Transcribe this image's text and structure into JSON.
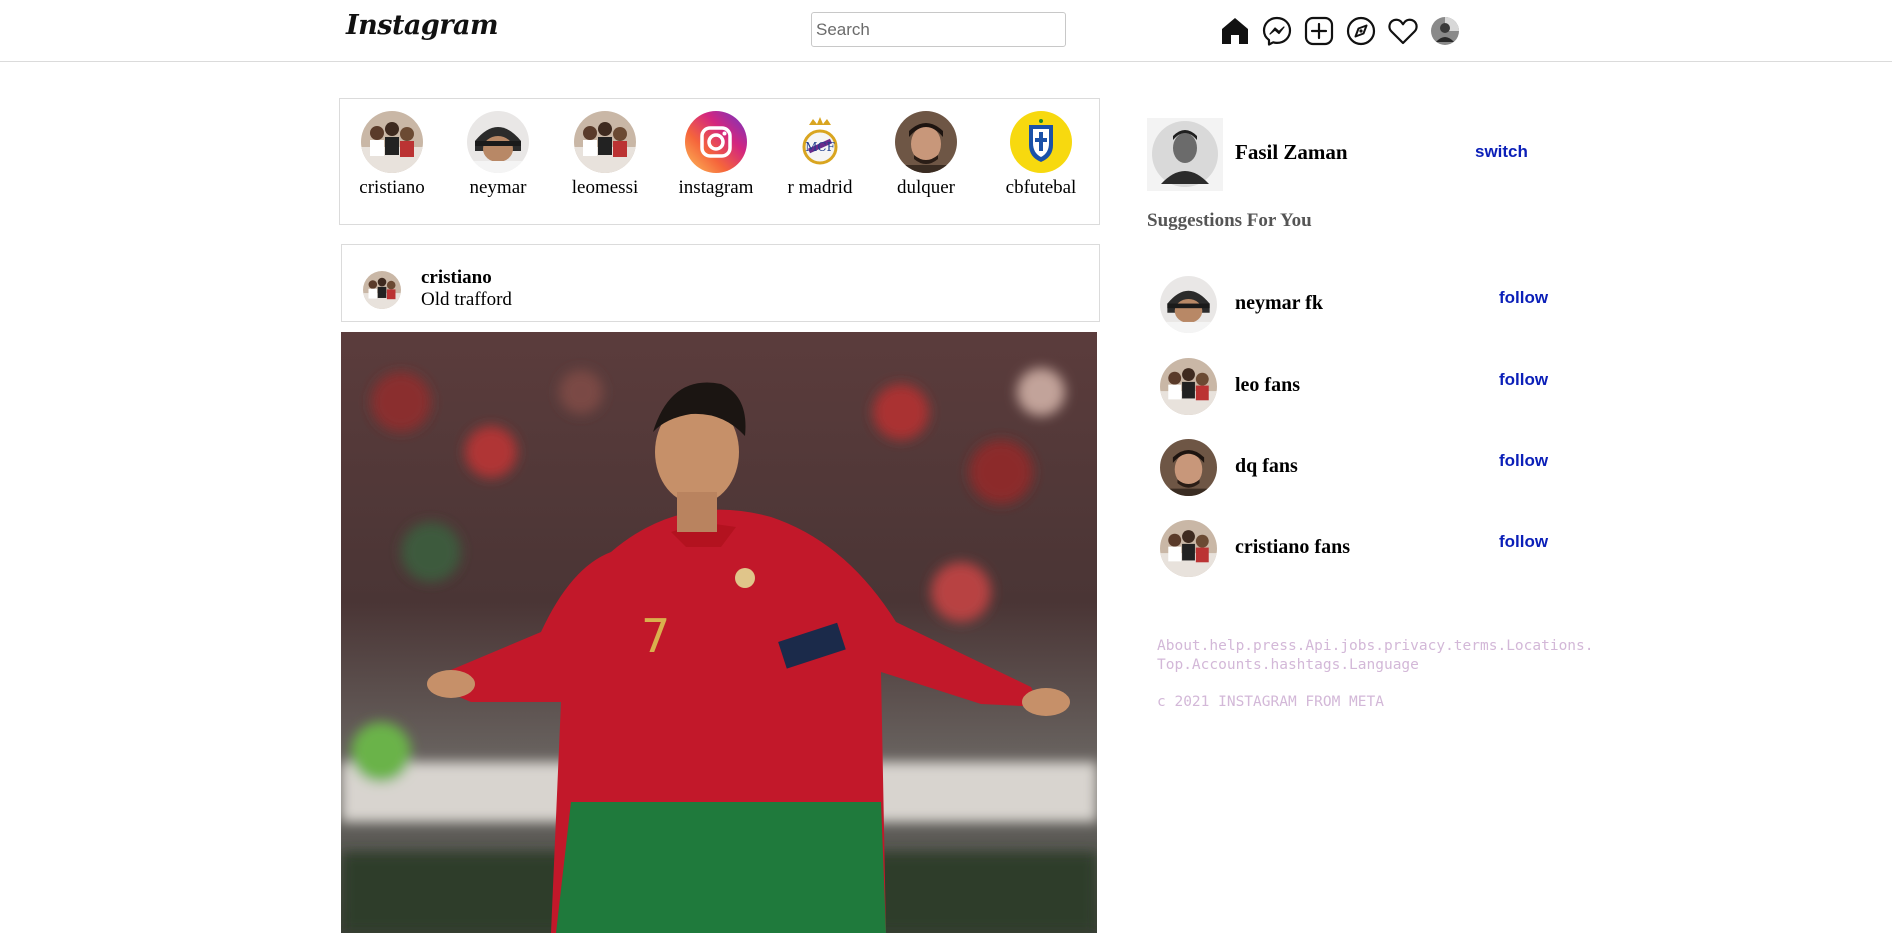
{
  "app": {
    "logo_text": "Instagram"
  },
  "search": {
    "placeholder": "Search",
    "value": ""
  },
  "nav_icons": [
    "home-icon",
    "messenger-icon",
    "new-post-icon",
    "explore-icon",
    "heart-icon",
    "profile-avatar"
  ],
  "stories": [
    {
      "name": "cristiano",
      "avatar": "group-photo"
    },
    {
      "name": "neymar",
      "avatar": "neymar-photo"
    },
    {
      "name": "leomessi",
      "avatar": "group-photo"
    },
    {
      "name": "instagram",
      "avatar": "instagram-logo"
    },
    {
      "name": "r madrid",
      "avatar": "real-madrid-crest"
    },
    {
      "name": "dulquer",
      "avatar": "dulquer-photo"
    },
    {
      "name": "cbfutebal",
      "avatar": "cbf-crest"
    }
  ],
  "post": {
    "username": "cristiano",
    "location": "Old trafford",
    "image": "footballer-in-red-jersey-number-7"
  },
  "current_user": {
    "name": "Fasil Zaman",
    "action": "switch"
  },
  "suggestions_title": "Suggestions For You",
  "suggestions": [
    {
      "name": "neymar fk",
      "action": "follow",
      "avatar": "neymar-photo"
    },
    {
      "name": "leo fans",
      "action": "follow",
      "avatar": "group-photo"
    },
    {
      "name": "dq fans",
      "action": "follow",
      "avatar": "dulquer-photo"
    },
    {
      "name": "cristiano fans",
      "action": "follow",
      "avatar": "group-photo"
    }
  ],
  "footer": {
    "links_line1": "About.help.press.Api.jobs.privacy.terms.Locations.",
    "links_line2": "Top.Accounts.hashtags.Language",
    "copyright": "c 2021 INSTAGRAM FROM META"
  },
  "colors": {
    "link_blue": "#0b1fb8",
    "border": "#dbdbdb",
    "footer_text": "#d3b8d8"
  }
}
